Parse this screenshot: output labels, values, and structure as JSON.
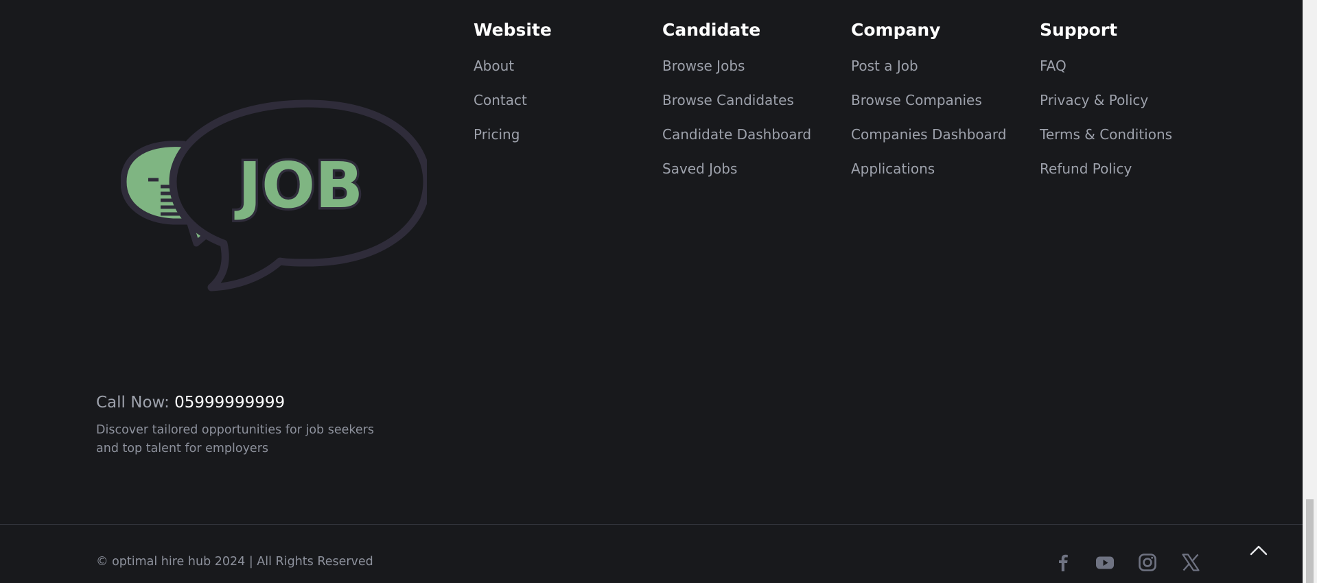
{
  "logo": {
    "text": "JOB",
    "colors": {
      "green": "#7fb582",
      "outline": "#2f2c3a"
    }
  },
  "columns": [
    {
      "title": "Website",
      "links": [
        "About",
        "Contact",
        "Pricing"
      ]
    },
    {
      "title": "Candidate",
      "links": [
        "Browse Jobs",
        "Browse Candidates",
        "Candidate Dashboard",
        "Saved Jobs"
      ]
    },
    {
      "title": "Company",
      "links": [
        "Post a Job",
        "Browse Companies",
        "Companies Dashboard",
        "Applications"
      ]
    },
    {
      "title": "Support",
      "links": [
        "FAQ",
        "Privacy & Policy",
        "Terms & Conditions",
        "Refund Policy"
      ]
    }
  ],
  "contact": {
    "call_label": "Call Now:",
    "phone": "05999999999",
    "description": "Discover tailored opportunities for job seekers and top talent for employers"
  },
  "bottom": {
    "copyright": "© optimal hire hub 2024 | All Rights Reserved",
    "social": [
      "facebook-icon",
      "youtube-icon",
      "instagram-icon",
      "x-twitter-icon"
    ],
    "back_to_top": "chevron-up-icon"
  },
  "colors": {
    "background": "#18191c",
    "heading": "#ffffff",
    "link": "#9da1ab",
    "muted": "#8d919c",
    "icon": "#6f7382"
  }
}
